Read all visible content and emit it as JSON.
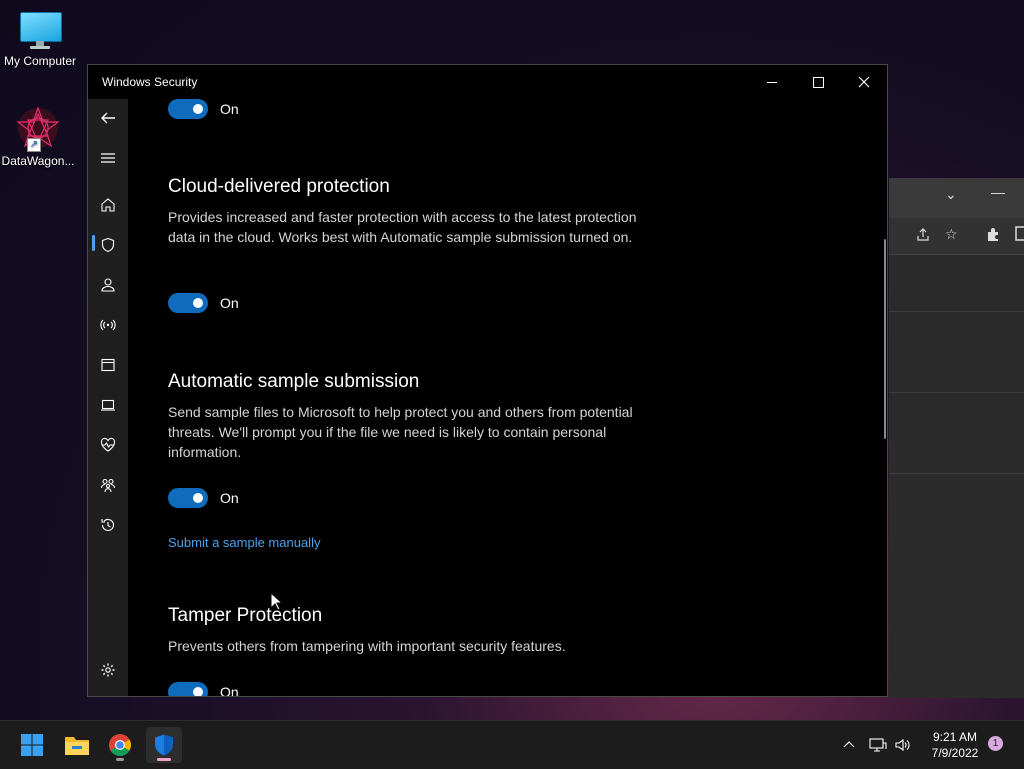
{
  "desktop": {
    "icons": [
      {
        "label": "My Computer"
      },
      {
        "label": "DataWagon..."
      }
    ]
  },
  "window": {
    "title": "Windows Security",
    "controls": {
      "minimize": "minimize",
      "maximize": "maximize",
      "close": "close"
    }
  },
  "sidebar": {
    "items": [
      {
        "icon": "back-arrow-icon"
      },
      {
        "icon": "hamburger-menu-icon"
      },
      {
        "icon": "home-icon"
      },
      {
        "icon": "shield-icon",
        "active": true
      },
      {
        "icon": "person-icon"
      },
      {
        "icon": "wireless-icon"
      },
      {
        "icon": "app-browser-icon"
      },
      {
        "icon": "laptop-icon"
      },
      {
        "icon": "heart-pulse-icon"
      },
      {
        "icon": "family-icon"
      },
      {
        "icon": "history-icon"
      },
      {
        "icon": "gear-icon"
      }
    ]
  },
  "content": {
    "top_toggle": {
      "state": "On"
    },
    "cloud": {
      "title": "Cloud-delivered protection",
      "description": "Provides increased and faster protection with access to the latest protection data in the cloud. Works best with Automatic sample submission turned on.",
      "toggle": "On"
    },
    "sample": {
      "title": "Automatic sample submission",
      "description": "Send sample files to Microsoft to help protect you and others from potential threats. We'll prompt you if the file we need is likely to contain personal information.",
      "toggle": "On",
      "link": "Submit a sample manually"
    },
    "tamper": {
      "title": "Tamper Protection",
      "description": "Prevents others from tampering with important security features.",
      "toggle": "On"
    }
  },
  "taskbar": {
    "apps": [
      {
        "icon": "windows-start-icon"
      },
      {
        "icon": "file-explorer-icon"
      },
      {
        "icon": "chrome-icon"
      },
      {
        "icon": "windows-security-icon"
      }
    ],
    "clock": {
      "time": "9:21 AM",
      "date": "7/9/2022"
    },
    "notification_count": "1"
  },
  "colors": {
    "accent": "#0f6cbd",
    "link": "#4ca0e8"
  }
}
